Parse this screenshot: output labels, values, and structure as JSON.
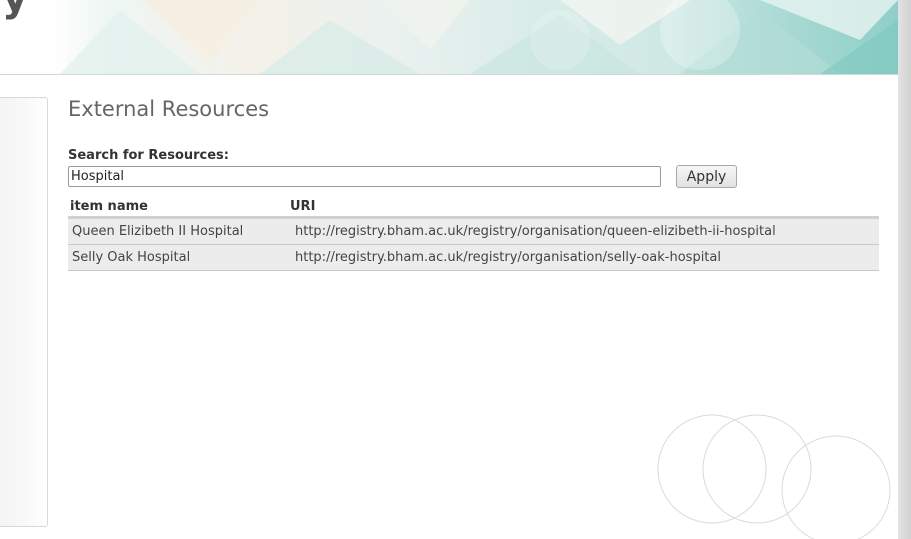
{
  "header": {
    "brand_fragment": "y"
  },
  "main": {
    "title": "External Resources",
    "search": {
      "label": "Search for Resources:",
      "value": "Hospital",
      "placeholder": ""
    },
    "apply_label": "Apply",
    "table": {
      "columns": [
        "item name",
        "URI"
      ],
      "rows": [
        {
          "name": "Queen Elizibeth II Hospital",
          "uri": "http://registry.bham.ac.uk/registry/organisation/queen-elizibeth-ii-hospital"
        },
        {
          "name": "Selly Oak Hospital",
          "uri": "http://registry.bham.ac.uk/registry/organisation/selly-oak-hospital"
        }
      ]
    }
  },
  "colors": {
    "row_background": "#ececec",
    "banner_accent": "#8fcfc8",
    "title_text": "#666666"
  }
}
